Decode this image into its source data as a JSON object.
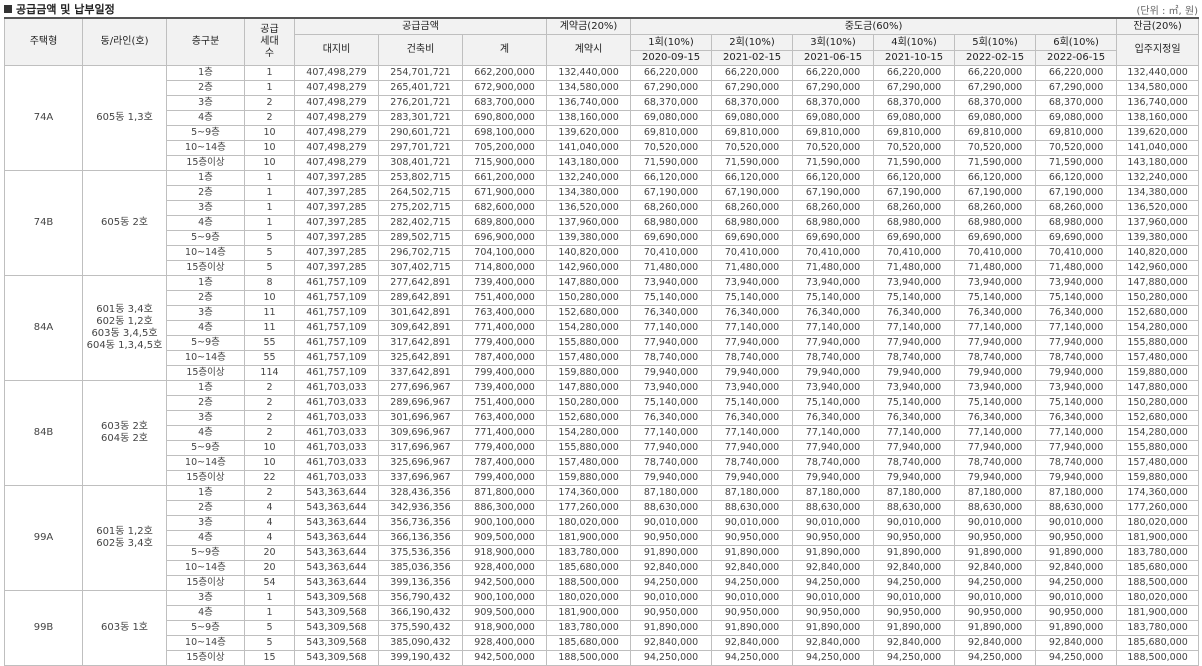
{
  "header": {
    "title": "공급금액 및 납부일정",
    "unit": "(단위 : ㎡, 원)"
  },
  "columns": {
    "type": "주택형",
    "dong": "동/라인(호)",
    "floor": "층구분",
    "households": "공급세대수",
    "supply_price": "공급금액",
    "land": "대지비",
    "building": "건축비",
    "total": "계",
    "contract": "계약금(20%)",
    "contract_when": "계약시",
    "middle": "중도금(60%)",
    "installments": [
      {
        "label": "1회(10%)",
        "date": "2020-09-15"
      },
      {
        "label": "2회(10%)",
        "date": "2021-02-15"
      },
      {
        "label": "3회(10%)",
        "date": "2021-06-15"
      },
      {
        "label": "4회(10%)",
        "date": "2021-10-15"
      },
      {
        "label": "5회(10%)",
        "date": "2022-02-15"
      },
      {
        "label": "6회(10%)",
        "date": "2022-06-15"
      }
    ],
    "balance": "잔금(20%)",
    "balance_when": "입주지정일"
  },
  "groups": [
    {
      "type": "74A",
      "dong": [
        "605동 1,3호"
      ],
      "rows": [
        {
          "floor": "1층",
          "households": "1",
          "land": "407,498,279",
          "building": "254,701,721",
          "total": "662,200,000",
          "contract": "132,440,000",
          "mid": "66,220,000",
          "balance": "132,440,000"
        },
        {
          "floor": "2층",
          "households": "1",
          "land": "407,498,279",
          "building": "265,401,721",
          "total": "672,900,000",
          "contract": "134,580,000",
          "mid": "67,290,000",
          "balance": "134,580,000"
        },
        {
          "floor": "3층",
          "households": "2",
          "land": "407,498,279",
          "building": "276,201,721",
          "total": "683,700,000",
          "contract": "136,740,000",
          "mid": "68,370,000",
          "balance": "136,740,000"
        },
        {
          "floor": "4층",
          "households": "2",
          "land": "407,498,279",
          "building": "283,301,721",
          "total": "690,800,000",
          "contract": "138,160,000",
          "mid": "69,080,000",
          "balance": "138,160,000"
        },
        {
          "floor": "5~9층",
          "households": "10",
          "land": "407,498,279",
          "building": "290,601,721",
          "total": "698,100,000",
          "contract": "139,620,000",
          "mid": "69,810,000",
          "balance": "139,620,000"
        },
        {
          "floor": "10~14층",
          "households": "10",
          "land": "407,498,279",
          "building": "297,701,721",
          "total": "705,200,000",
          "contract": "141,040,000",
          "mid": "70,520,000",
          "balance": "141,040,000"
        },
        {
          "floor": "15층이상",
          "households": "10",
          "land": "407,498,279",
          "building": "308,401,721",
          "total": "715,900,000",
          "contract": "143,180,000",
          "mid": "71,590,000",
          "balance": "143,180,000"
        }
      ]
    },
    {
      "type": "74B",
      "dong": [
        "605동 2호"
      ],
      "rows": [
        {
          "floor": "1층",
          "households": "1",
          "land": "407,397,285",
          "building": "253,802,715",
          "total": "661,200,000",
          "contract": "132,240,000",
          "mid": "66,120,000",
          "balance": "132,240,000"
        },
        {
          "floor": "2층",
          "households": "1",
          "land": "407,397,285",
          "building": "264,502,715",
          "total": "671,900,000",
          "contract": "134,380,000",
          "mid": "67,190,000",
          "balance": "134,380,000"
        },
        {
          "floor": "3층",
          "households": "1",
          "land": "407,397,285",
          "building": "275,202,715",
          "total": "682,600,000",
          "contract": "136,520,000",
          "mid": "68,260,000",
          "balance": "136,520,000"
        },
        {
          "floor": "4층",
          "households": "1",
          "land": "407,397,285",
          "building": "282,402,715",
          "total": "689,800,000",
          "contract": "137,960,000",
          "mid": "68,980,000",
          "balance": "137,960,000"
        },
        {
          "floor": "5~9층",
          "households": "5",
          "land": "407,397,285",
          "building": "289,502,715",
          "total": "696,900,000",
          "contract": "139,380,000",
          "mid": "69,690,000",
          "balance": "139,380,000"
        },
        {
          "floor": "10~14층",
          "households": "5",
          "land": "407,397,285",
          "building": "296,702,715",
          "total": "704,100,000",
          "contract": "140,820,000",
          "mid": "70,410,000",
          "balance": "140,820,000"
        },
        {
          "floor": "15층이상",
          "households": "5",
          "land": "407,397,285",
          "building": "307,402,715",
          "total": "714,800,000",
          "contract": "142,960,000",
          "mid": "71,480,000",
          "balance": "142,960,000"
        }
      ]
    },
    {
      "type": "84A",
      "dong": [
        "601동 3,4호",
        "602동 1,2호",
        "603동 3,4,5호",
        "604동 1,3,4,5호"
      ],
      "rows": [
        {
          "floor": "1층",
          "households": "8",
          "land": "461,757,109",
          "building": "277,642,891",
          "total": "739,400,000",
          "contract": "147,880,000",
          "mid": "73,940,000",
          "balance": "147,880,000"
        },
        {
          "floor": "2층",
          "households": "10",
          "land": "461,757,109",
          "building": "289,642,891",
          "total": "751,400,000",
          "contract": "150,280,000",
          "mid": "75,140,000",
          "balance": "150,280,000"
        },
        {
          "floor": "3층",
          "households": "11",
          "land": "461,757,109",
          "building": "301,642,891",
          "total": "763,400,000",
          "contract": "152,680,000",
          "mid": "76,340,000",
          "balance": "152,680,000"
        },
        {
          "floor": "4층",
          "households": "11",
          "land": "461,757,109",
          "building": "309,642,891",
          "total": "771,400,000",
          "contract": "154,280,000",
          "mid": "77,140,000",
          "balance": "154,280,000"
        },
        {
          "floor": "5~9층",
          "households": "55",
          "land": "461,757,109",
          "building": "317,642,891",
          "total": "779,400,000",
          "contract": "155,880,000",
          "mid": "77,940,000",
          "balance": "155,880,000"
        },
        {
          "floor": "10~14층",
          "households": "55",
          "land": "461,757,109",
          "building": "325,642,891",
          "total": "787,400,000",
          "contract": "157,480,000",
          "mid": "78,740,000",
          "balance": "157,480,000"
        },
        {
          "floor": "15층이상",
          "households": "114",
          "land": "461,757,109",
          "building": "337,642,891",
          "total": "799,400,000",
          "contract": "159,880,000",
          "mid": "79,940,000",
          "balance": "159,880,000"
        }
      ]
    },
    {
      "type": "84B",
      "dong": [
        "603동 2호",
        "604동 2호"
      ],
      "rows": [
        {
          "floor": "1층",
          "households": "2",
          "land": "461,703,033",
          "building": "277,696,967",
          "total": "739,400,000",
          "contract": "147,880,000",
          "mid": "73,940,000",
          "balance": "147,880,000"
        },
        {
          "floor": "2층",
          "households": "2",
          "land": "461,703,033",
          "building": "289,696,967",
          "total": "751,400,000",
          "contract": "150,280,000",
          "mid": "75,140,000",
          "balance": "150,280,000"
        },
        {
          "floor": "3층",
          "households": "2",
          "land": "461,703,033",
          "building": "301,696,967",
          "total": "763,400,000",
          "contract": "152,680,000",
          "mid": "76,340,000",
          "balance": "152,680,000"
        },
        {
          "floor": "4층",
          "households": "2",
          "land": "461,703,033",
          "building": "309,696,967",
          "total": "771,400,000",
          "contract": "154,280,000",
          "mid": "77,140,000",
          "balance": "154,280,000"
        },
        {
          "floor": "5~9층",
          "households": "10",
          "land": "461,703,033",
          "building": "317,696,967",
          "total": "779,400,000",
          "contract": "155,880,000",
          "mid": "77,940,000",
          "balance": "155,880,000"
        },
        {
          "floor": "10~14층",
          "households": "10",
          "land": "461,703,033",
          "building": "325,696,967",
          "total": "787,400,000",
          "contract": "157,480,000",
          "mid": "78,740,000",
          "balance": "157,480,000"
        },
        {
          "floor": "15층이상",
          "households": "22",
          "land": "461,703,033",
          "building": "337,696,967",
          "total": "799,400,000",
          "contract": "159,880,000",
          "mid": "79,940,000",
          "balance": "159,880,000"
        }
      ]
    },
    {
      "type": "99A",
      "dong": [
        "601동 1,2호",
        "602동 3,4호"
      ],
      "rows": [
        {
          "floor": "1층",
          "households": "2",
          "land": "543,363,644",
          "building": "328,436,356",
          "total": "871,800,000",
          "contract": "174,360,000",
          "mid": "87,180,000",
          "balance": "174,360,000"
        },
        {
          "floor": "2층",
          "households": "4",
          "land": "543,363,644",
          "building": "342,936,356",
          "total": "886,300,000",
          "contract": "177,260,000",
          "mid": "88,630,000",
          "balance": "177,260,000"
        },
        {
          "floor": "3층",
          "households": "4",
          "land": "543,363,644",
          "building": "356,736,356",
          "total": "900,100,000",
          "contract": "180,020,000",
          "mid": "90,010,000",
          "balance": "180,020,000"
        },
        {
          "floor": "4층",
          "households": "4",
          "land": "543,363,644",
          "building": "366,136,356",
          "total": "909,500,000",
          "contract": "181,900,000",
          "mid": "90,950,000",
          "balance": "181,900,000"
        },
        {
          "floor": "5~9층",
          "households": "20",
          "land": "543,363,644",
          "building": "375,536,356",
          "total": "918,900,000",
          "contract": "183,780,000",
          "mid": "91,890,000",
          "balance": "183,780,000"
        },
        {
          "floor": "10~14층",
          "households": "20",
          "land": "543,363,644",
          "building": "385,036,356",
          "total": "928,400,000",
          "contract": "185,680,000",
          "mid": "92,840,000",
          "balance": "185,680,000"
        },
        {
          "floor": "15층이상",
          "households": "54",
          "land": "543,363,644",
          "building": "399,136,356",
          "total": "942,500,000",
          "contract": "188,500,000",
          "mid": "94,250,000",
          "balance": "188,500,000"
        }
      ]
    },
    {
      "type": "99B",
      "dong": [
        "603동 1호"
      ],
      "rows": [
        {
          "floor": "3층",
          "households": "1",
          "land": "543,309,568",
          "building": "356,790,432",
          "total": "900,100,000",
          "contract": "180,020,000",
          "mid": "90,010,000",
          "balance": "180,020,000"
        },
        {
          "floor": "4층",
          "households": "1",
          "land": "543,309,568",
          "building": "366,190,432",
          "total": "909,500,000",
          "contract": "181,900,000",
          "mid": "90,950,000",
          "balance": "181,900,000"
        },
        {
          "floor": "5~9층",
          "households": "5",
          "land": "543,309,568",
          "building": "375,590,432",
          "total": "918,900,000",
          "contract": "183,780,000",
          "mid": "91,890,000",
          "balance": "183,780,000"
        },
        {
          "floor": "10~14층",
          "households": "5",
          "land": "543,309,568",
          "building": "385,090,432",
          "total": "928,400,000",
          "contract": "185,680,000",
          "mid": "92,840,000",
          "balance": "185,680,000"
        },
        {
          "floor": "15층이상",
          "households": "15",
          "land": "543,309,568",
          "building": "399,190,432",
          "total": "942,500,000",
          "contract": "188,500,000",
          "mid": "94,250,000",
          "balance": "188,500,000"
        }
      ]
    }
  ]
}
